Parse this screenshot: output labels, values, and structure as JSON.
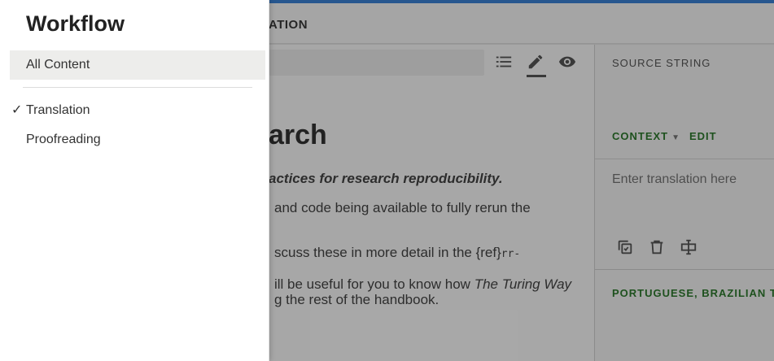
{
  "topbar": {
    "tab_label": "ATION"
  },
  "document": {
    "heading": "arch",
    "subtitle": "actices for research reproducibility.",
    "line1": "and code being available to fully rerun the",
    "line2_text": "scuss these in more detail in the {ref}",
    "line2_mono": "rr-",
    "line3_pre": "ill be useful for you to know how ",
    "line3_em": "The Turing Way",
    "line4": "g the rest of the handbook."
  },
  "right_pane": {
    "source_label": "SOURCE STRING",
    "context_label": "CONTEXT",
    "edit_label": "EDIT",
    "translation_placeholder": "Enter translation here",
    "language_label": "PORTUGUESE, BRAZILIAN TRA"
  },
  "drawer": {
    "title": "Workflow",
    "items": [
      {
        "label": "All Content",
        "selected": true
      },
      {
        "label": "Translation",
        "checked": true
      },
      {
        "label": "Proofreading"
      }
    ],
    "check_mark": "✓"
  },
  "colors": {
    "accent": "#3b82d6",
    "green": "#2d7a2d"
  },
  "icons": {
    "list": "list-icon",
    "edit": "pencil-icon",
    "preview": "eye-icon",
    "copy": "copy-icon",
    "delete": "trash-icon",
    "split": "text-cursor-icon"
  }
}
